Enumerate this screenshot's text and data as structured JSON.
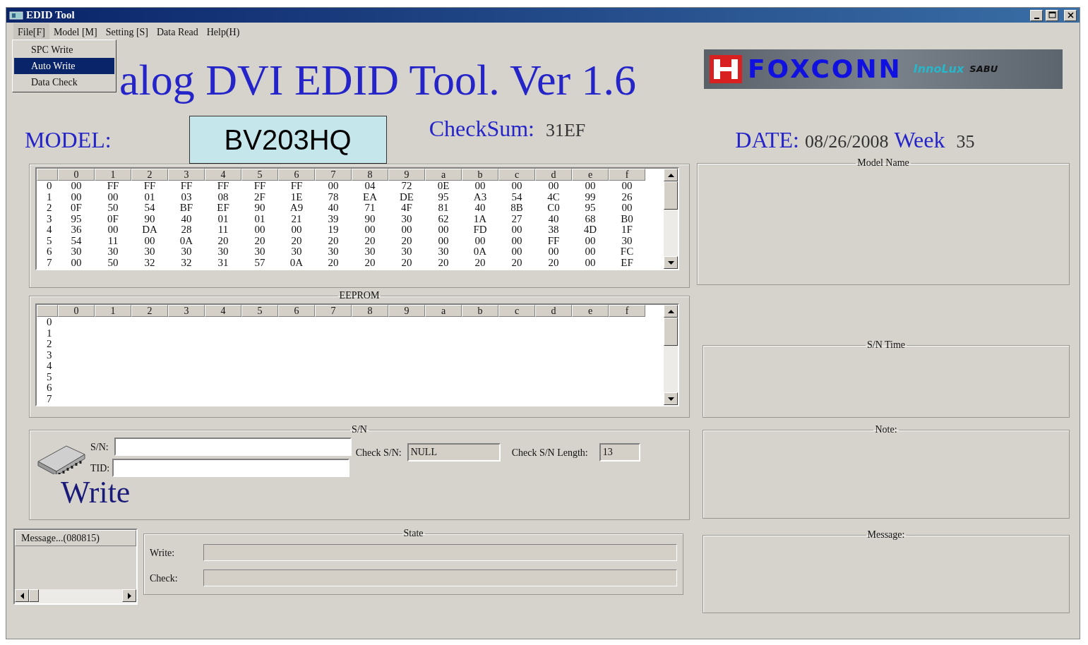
{
  "window": {
    "title": "EDID Tool"
  },
  "menu": [
    {
      "label": "File[F]",
      "selected": true
    },
    {
      "label": "Model [M]",
      "selected": false
    },
    {
      "label": "Setting [S]",
      "selected": false
    },
    {
      "label": "Data Read",
      "selected": false
    },
    {
      "label": "Help(H)",
      "selected": false
    }
  ],
  "file_menu": [
    {
      "label": "SPC Write",
      "selected": false
    },
    {
      "label": "Auto Write",
      "selected": true
    },
    {
      "label": "Data Check",
      "selected": false
    }
  ],
  "heading": "alog DVI EDID Tool. Ver 1.6",
  "logo": {
    "brand": "FOXCONN",
    "sub": "InnoLux",
    "tag": "SABU"
  },
  "model": {
    "label": "MODEL:",
    "value": "BV203HQ"
  },
  "checksum": {
    "label": "CheckSum:",
    "value": "31EF"
  },
  "date": {
    "label": "DATE:",
    "value": "08/26/2008",
    "week_label": "Week",
    "week": "35"
  },
  "edid_grid": {
    "columns": [
      "0",
      "1",
      "2",
      "3",
      "4",
      "5",
      "6",
      "7",
      "8",
      "9",
      "a",
      "b",
      "c",
      "d",
      "e",
      "f"
    ],
    "rows": [
      {
        "label": "0",
        "cells": [
          "00",
          "FF",
          "FF",
          "FF",
          "FF",
          "FF",
          "FF",
          "00",
          "04",
          "72",
          "0E",
          "00",
          "00",
          "00",
          "00",
          "00"
        ]
      },
      {
        "label": "1",
        "cells": [
          "00",
          "00",
          "01",
          "03",
          "08",
          "2F",
          "1E",
          "78",
          "EA",
          "DE",
          "95",
          "A3",
          "54",
          "4C",
          "99",
          "26"
        ]
      },
      {
        "label": "2",
        "cells": [
          "0F",
          "50",
          "54",
          "BF",
          "EF",
          "90",
          "A9",
          "40",
          "71",
          "4F",
          "81",
          "40",
          "8B",
          "C0",
          "95",
          "00"
        ]
      },
      {
        "label": "3",
        "cells": [
          "95",
          "0F",
          "90",
          "40",
          "01",
          "01",
          "21",
          "39",
          "90",
          "30",
          "62",
          "1A",
          "27",
          "40",
          "68",
          "B0"
        ]
      },
      {
        "label": "4",
        "cells": [
          "36",
          "00",
          "DA",
          "28",
          "11",
          "00",
          "00",
          "19",
          "00",
          "00",
          "00",
          "FD",
          "00",
          "38",
          "4D",
          "1F"
        ]
      },
      {
        "label": "5",
        "cells": [
          "54",
          "11",
          "00",
          "0A",
          "20",
          "20",
          "20",
          "20",
          "20",
          "20",
          "00",
          "00",
          "00",
          "FF",
          "00",
          "30"
        ]
      },
      {
        "label": "6",
        "cells": [
          "30",
          "30",
          "30",
          "30",
          "30",
          "30",
          "30",
          "30",
          "30",
          "30",
          "30",
          "0A",
          "00",
          "00",
          "00",
          "FC"
        ]
      },
      {
        "label": "7",
        "cells": [
          "00",
          "50",
          "32",
          "32",
          "31",
          "57",
          "0A",
          "20",
          "20",
          "20",
          "20",
          "20",
          "20",
          "20",
          "00",
          "EF"
        ]
      }
    ]
  },
  "eeprom_grid": {
    "title": "EEPROM",
    "columns": [
      "0",
      "1",
      "2",
      "3",
      "4",
      "5",
      "6",
      "7",
      "8",
      "9",
      "a",
      "b",
      "c",
      "d",
      "e",
      "f"
    ],
    "rows": [
      {
        "label": "0"
      },
      {
        "label": "1"
      },
      {
        "label": "2"
      },
      {
        "label": "3"
      },
      {
        "label": "4"
      },
      {
        "label": "5"
      },
      {
        "label": "6"
      },
      {
        "label": "7"
      }
    ]
  },
  "sn_group": {
    "title": "S/N",
    "sn_label": "S/N:",
    "tid_label": "TID:",
    "check_sn_label": "Check S/N:",
    "check_sn_value": "NULL",
    "check_len_label": "Check S/N Length:",
    "check_len_value": "13",
    "write_label": "Write"
  },
  "message_list": {
    "header": "Message...(080815)"
  },
  "state": {
    "title": "State",
    "bars": [
      {
        "label": "Write:"
      },
      {
        "label": "Check:"
      }
    ]
  },
  "right_panels": [
    {
      "title": "Model Name"
    },
    {
      "title": "S/N Time"
    },
    {
      "title": "Note:"
    },
    {
      "title": "Message:"
    }
  ]
}
